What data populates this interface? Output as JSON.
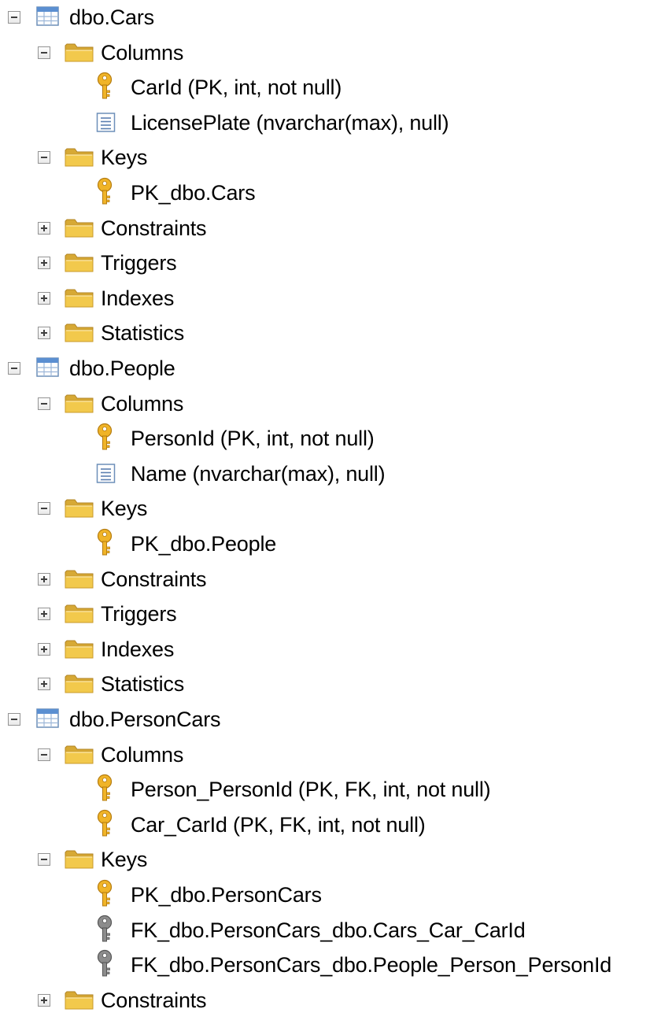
{
  "tree": {
    "nodes": [
      {
        "label": "dbo.Cars",
        "level": 0,
        "toggle": "minus",
        "icon": "table-icon",
        "kind": "table"
      },
      {
        "label": "Columns",
        "level": 1,
        "toggle": "minus",
        "icon": "folder-icon",
        "kind": "folder"
      },
      {
        "label": "CarId (PK, int, not null)",
        "level": 2,
        "toggle": "none",
        "icon": "primary-key-icon",
        "kind": "column"
      },
      {
        "label": "LicensePlate (nvarchar(max), null)",
        "level": 2,
        "toggle": "none",
        "icon": "column-icon",
        "kind": "column"
      },
      {
        "label": "Keys",
        "level": 1,
        "toggle": "minus",
        "icon": "folder-icon",
        "kind": "folder"
      },
      {
        "label": "PK_dbo.Cars",
        "level": 2,
        "toggle": "none",
        "icon": "primary-key-icon",
        "kind": "key"
      },
      {
        "label": "Constraints",
        "level": 1,
        "toggle": "plus",
        "icon": "folder-icon",
        "kind": "folder"
      },
      {
        "label": "Triggers",
        "level": 1,
        "toggle": "plus",
        "icon": "folder-icon",
        "kind": "folder"
      },
      {
        "label": "Indexes",
        "level": 1,
        "toggle": "plus",
        "icon": "folder-icon",
        "kind": "folder"
      },
      {
        "label": "Statistics",
        "level": 1,
        "toggle": "plus",
        "icon": "folder-icon",
        "kind": "folder"
      },
      {
        "label": "dbo.People",
        "level": 0,
        "toggle": "minus",
        "icon": "table-icon",
        "kind": "table"
      },
      {
        "label": "Columns",
        "level": 1,
        "toggle": "minus",
        "icon": "folder-icon",
        "kind": "folder"
      },
      {
        "label": "PersonId (PK, int, not null)",
        "level": 2,
        "toggle": "none",
        "icon": "primary-key-icon",
        "kind": "column"
      },
      {
        "label": "Name (nvarchar(max), null)",
        "level": 2,
        "toggle": "none",
        "icon": "column-icon",
        "kind": "column"
      },
      {
        "label": "Keys",
        "level": 1,
        "toggle": "minus",
        "icon": "folder-icon",
        "kind": "folder"
      },
      {
        "label": "PK_dbo.People",
        "level": 2,
        "toggle": "none",
        "icon": "primary-key-icon",
        "kind": "key"
      },
      {
        "label": "Constraints",
        "level": 1,
        "toggle": "plus",
        "icon": "folder-icon",
        "kind": "folder"
      },
      {
        "label": "Triggers",
        "level": 1,
        "toggle": "plus",
        "icon": "folder-icon",
        "kind": "folder"
      },
      {
        "label": "Indexes",
        "level": 1,
        "toggle": "plus",
        "icon": "folder-icon",
        "kind": "folder"
      },
      {
        "label": "Statistics",
        "level": 1,
        "toggle": "plus",
        "icon": "folder-icon",
        "kind": "folder"
      },
      {
        "label": "dbo.PersonCars",
        "level": 0,
        "toggle": "minus",
        "icon": "table-icon",
        "kind": "table"
      },
      {
        "label": "Columns",
        "level": 1,
        "toggle": "minus",
        "icon": "folder-icon",
        "kind": "folder"
      },
      {
        "label": "Person_PersonId (PK, FK, int, not null)",
        "level": 2,
        "toggle": "none",
        "icon": "primary-key-icon",
        "kind": "column"
      },
      {
        "label": "Car_CarId (PK, FK, int, not null)",
        "level": 2,
        "toggle": "none",
        "icon": "primary-key-icon",
        "kind": "column"
      },
      {
        "label": "Keys",
        "level": 1,
        "toggle": "minus",
        "icon": "folder-icon",
        "kind": "folder"
      },
      {
        "label": "PK_dbo.PersonCars",
        "level": 2,
        "toggle": "none",
        "icon": "primary-key-icon",
        "kind": "key"
      },
      {
        "label": "FK_dbo.PersonCars_dbo.Cars_Car_CarId",
        "level": 2,
        "toggle": "none",
        "icon": "foreign-key-icon",
        "kind": "key"
      },
      {
        "label": "FK_dbo.PersonCars_dbo.People_Person_PersonId",
        "level": 2,
        "toggle": "none",
        "icon": "foreign-key-icon",
        "kind": "key"
      },
      {
        "label": "Constraints",
        "level": 1,
        "toggle": "plus",
        "icon": "folder-icon",
        "kind": "folder"
      }
    ]
  },
  "colors": {
    "background": "#ffffff",
    "text": "#000000",
    "folder": "#f2c94c",
    "primary_key": "#f0b428",
    "foreign_key": "#8c8c8c",
    "table_icon": "#5b8fd1"
  }
}
